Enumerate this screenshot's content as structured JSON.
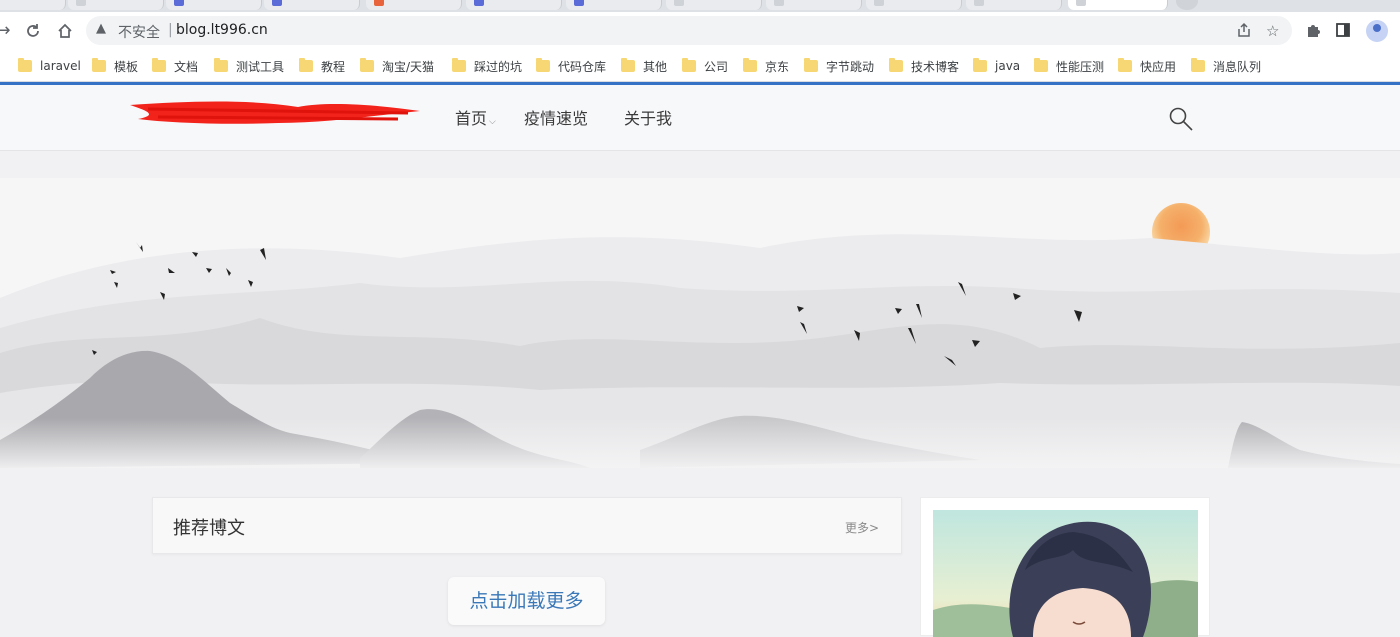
{
  "browser": {
    "tab_favicon_colors": [
      "#cfd3d8",
      "#cfd3d8",
      "#5b6bd8",
      "#5b6bd8",
      "#e8643c",
      "#5b6bd8",
      "#5b6bd8",
      "#cfd3d8",
      "#cfd3d8",
      "#cfd3d8",
      "#cfd3d8",
      "#cfd3d8"
    ],
    "address": {
      "security_label": "不安全",
      "url": "blog.lt996.cn"
    },
    "bookmarks": [
      {
        "label": "laravel"
      },
      {
        "label": "模板"
      },
      {
        "label": "文档"
      },
      {
        "label": "测试工具"
      },
      {
        "label": "教程"
      },
      {
        "label": "淘宝/天猫"
      },
      {
        "label": "踩过的坑"
      },
      {
        "label": "代码仓库"
      },
      {
        "label": "其他"
      },
      {
        "label": "公司"
      },
      {
        "label": "京东"
      },
      {
        "label": "字节跳动"
      },
      {
        "label": "技术博客"
      },
      {
        "label": "java"
      },
      {
        "label": "性能压测"
      },
      {
        "label": "快应用"
      },
      {
        "label": "消息队列"
      }
    ]
  },
  "site": {
    "nav": [
      {
        "label": "首页",
        "has_dropdown": true
      },
      {
        "label": "疫情速览"
      },
      {
        "label": "关于我"
      }
    ],
    "recommended": {
      "title": "推荐博文",
      "more": "更多>"
    },
    "load_more": "点击加载更多"
  },
  "colors": {
    "accent_line": "#3572c6",
    "link": "#3b78b8",
    "sun": "#f5a35a"
  }
}
